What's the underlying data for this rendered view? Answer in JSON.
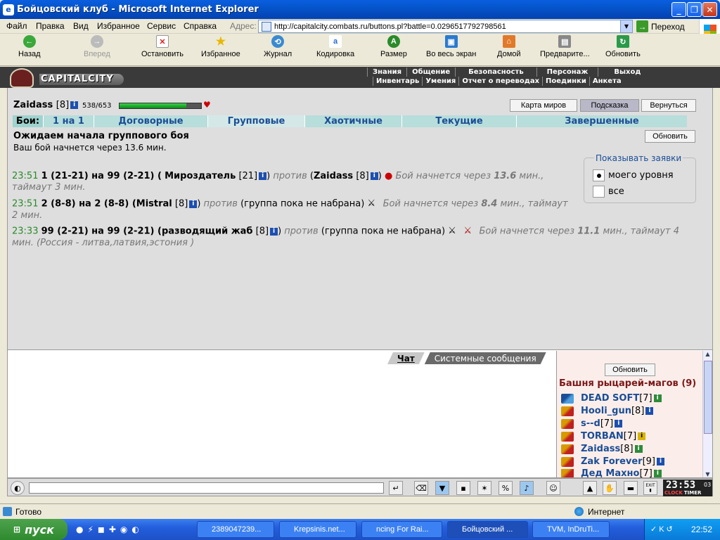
{
  "window": {
    "title": "Бойцовский клуб - Microsoft Internet Explorer"
  },
  "menu": [
    "Файл",
    "Правка",
    "Вид",
    "Избранное",
    "Сервис",
    "Справка"
  ],
  "address": {
    "label": "Адрес:",
    "url": "http://capitalcity.combats.ru/buttons.pl?battle=0.0296517792798561",
    "go": "Переход"
  },
  "toolbar": {
    "back": "Назад",
    "forward": "Вперед",
    "stop": "Остановить",
    "favorites": "Избранное",
    "history": "Журнал",
    "encoding": "Кодировка",
    "size": "Размер",
    "fullscreen": "Во весь экран",
    "home": "Домой",
    "preview": "Предварите...",
    "refresh": "Обновить"
  },
  "banner": {
    "brand": "CAPITALCITY"
  },
  "topnav": [
    "Знания",
    "Общение",
    "Безопасность",
    "Персонаж",
    "Выход"
  ],
  "subnav": [
    "Инвентарь",
    "Умения",
    "Отчет о переводах",
    "Поединки",
    "Анкета"
  ],
  "player": {
    "name": "Zaidass",
    "level": "[8]",
    "hp": "538/653",
    "hp_fraction": 0.82
  },
  "buttons": {
    "map": "Карта миров",
    "hint": "Подсказка",
    "back": "Вернуться",
    "refresh": "Обновить"
  },
  "tabs": {
    "label": "Бои:",
    "items": [
      "1 на 1",
      "Договорные",
      "Групповые",
      "Хаотичные",
      "Текущие",
      "Завершенные"
    ]
  },
  "wait": {
    "title": "Ожидаем начала группового боя",
    "subtitle": "Ваш бой начнется через 13.6 мин."
  },
  "filter": {
    "title": "Показывать заявки",
    "options": [
      "моего уровня",
      "все"
    ]
  },
  "fights": [
    {
      "time": "23:51",
      "a": "1 (21-21) на 99 (2-21) (",
      "p1": "Мироздатель",
      "p1lvl": "[21]",
      "vs": "против",
      "p2": "Zaidass",
      "p2lvl": "[8]",
      "rest_label": "Бой начнется через",
      "rest_val": "13.6",
      "rest_tail": "мин., таймаут 3 мин."
    },
    {
      "time": "23:51",
      "a": "2 (8-8) на 2 (8-8) (",
      "p1": "Mistral",
      "p1lvl": "[8]",
      "vs": "против",
      "group": "(группа пока не набрана)",
      "rest_label": "Бой начнется через",
      "rest_val": "8.4",
      "rest_tail": "мин., таймаут 2 мин."
    },
    {
      "time": "23:33",
      "a": "99 (2-21) на 99 (2-21) (",
      "p1": "разводящий жаб",
      "p1lvl": "[8]",
      "vs": "против",
      "group": "(группа пока не набрана)",
      "rest_label": "Бой начнется через",
      "rest_val": "11.1",
      "rest_tail": "мин., таймаут 4 мин. (Россия - литва,латвия,эстония )"
    }
  ],
  "chat": {
    "tab_chat": "Чат",
    "tab_system": "Системные сообщения"
  },
  "online": {
    "refresh": "Обновить",
    "room": "Башня рыцарей-магов (9)",
    "users": [
      {
        "name": "DEAD SOFT",
        "lvl": "[7]"
      },
      {
        "name": "Hooli_gun",
        "lvl": "[8]"
      },
      {
        "name": "s--d",
        "lvl": "[7]"
      },
      {
        "name": "TORBAN",
        "lvl": "[7]"
      },
      {
        "name": "Zaidass",
        "lvl": "[8]"
      },
      {
        "name": "Zak Forever",
        "lvl": "[9]"
      },
      {
        "name": "Дед Махно",
        "lvl": "[7]"
      }
    ]
  },
  "clock": {
    "time": "23:53",
    "sec": "03",
    "l1": "CLOCK",
    "l2": "TIMER",
    "exit": "EXIT"
  },
  "status": {
    "ready": "Готово",
    "zone": "Интернет"
  },
  "taskbar": {
    "start": "пуск",
    "tasks": [
      "2389047239...",
      "Krepsinis.net...",
      "ncing For Rai...",
      "Бойцовский ...",
      "TVM, InDruTi..."
    ],
    "time": "22:52"
  },
  "colors": {
    "xp_blue": "#0553c8",
    "tab_bg": "#b7dedb",
    "link": "#1b4d96",
    "room": "#7a1818"
  }
}
